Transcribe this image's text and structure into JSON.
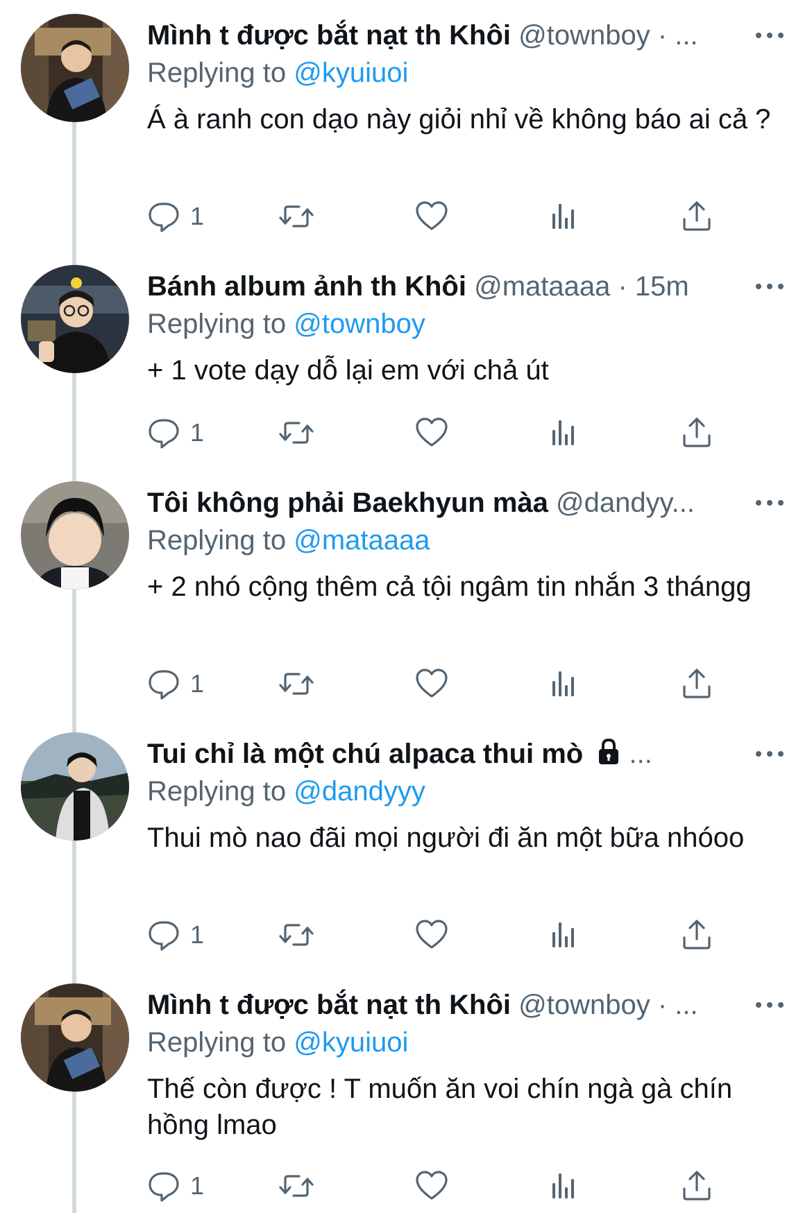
{
  "replying_to_label": "Replying to",
  "tweets": [
    {
      "name": "Mình t được bắt nạt th Khôi",
      "handle": "@townboy · ...",
      "reply_to": "@kyuiuoi",
      "text": "Á à ranh con dạo này giỏi nhỉ về không báo ai cả ?",
      "reply_count": "1",
      "avatar": "avatar-townboy"
    },
    {
      "name": "Bánh album ảnh th Khôi",
      "handle": "@mataaaa · 15m",
      "reply_to": "@townboy",
      "text": "+ 1 vote dạy dỗ lại em với chả út",
      "reply_count": "1",
      "avatar": "avatar-mataaaa"
    },
    {
      "name": "Tôi không phải Baekhyun màa",
      "handle": "@dandyy...",
      "reply_to": "@mataaaa",
      "text": "+ 2 nhó cộng thêm cả tội ngâm tin nhắn 3 thángg",
      "reply_count": "1",
      "avatar": "avatar-dandyyy"
    },
    {
      "name": "Tui chỉ là một chú alpaca thui mò",
      "handle": "...",
      "reply_to": "@dandyyy",
      "text": "Thui mò nao đãi mọi người đi ăn một bữa nhóoo",
      "reply_count": "1",
      "avatar": "avatar-alpaca",
      "protected": true
    },
    {
      "name": "Mình t được bắt nạt th Khôi",
      "handle": "@townboy · ...",
      "reply_to": "@kyuiuoi",
      "text": "Thế còn được ! T muốn ăn voi chín ngà gà chín hồng lmao",
      "reply_count": "1",
      "avatar": "avatar-townboy"
    }
  ],
  "colors": {
    "text": "#0f1419",
    "secondary": "#536471",
    "link": "#1d9bf0",
    "thread_line": "#cfd9de"
  },
  "icons": [
    "comment-icon",
    "retweet-icon",
    "like-icon",
    "views-icon",
    "share-icon",
    "more-icon",
    "lock-icon"
  ]
}
